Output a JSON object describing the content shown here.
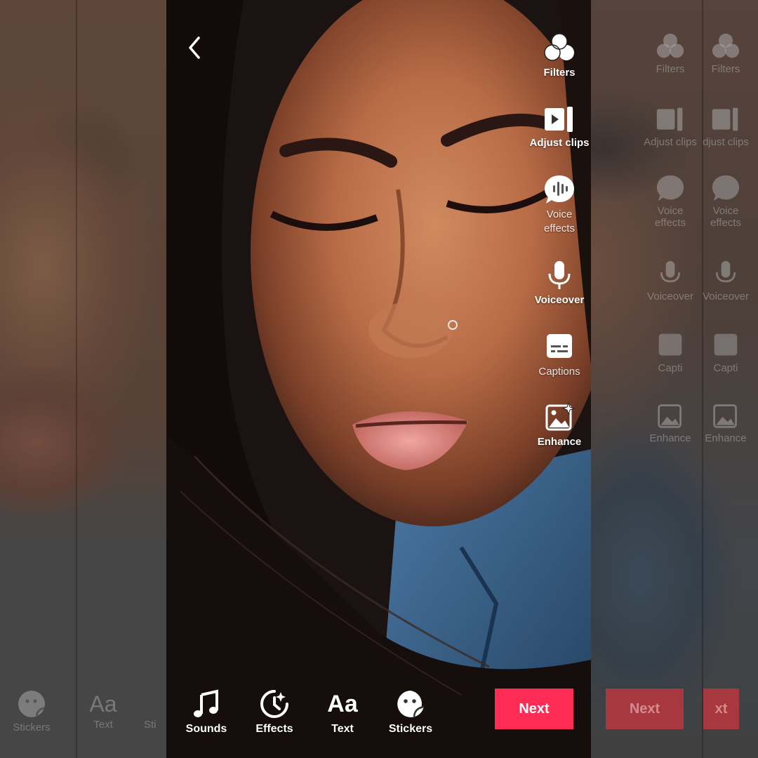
{
  "colors": {
    "accent": "#fe2c55",
    "ghost_accent": "#a8383f",
    "icon": "#ffffff"
  },
  "nav": {
    "back_icon": "chevron-left-icon"
  },
  "side_tools": [
    {
      "id": "filters",
      "label": "Filters",
      "icon": "filters-icon"
    },
    {
      "id": "adjust_clips",
      "label": "Adjust clips",
      "icon": "adjust-clips-icon"
    },
    {
      "id": "voice_effects",
      "label": "Voice\neffects",
      "icon": "voice-effects-icon"
    },
    {
      "id": "voiceover",
      "label": "Voiceover",
      "icon": "microphone-icon"
    },
    {
      "id": "captions",
      "label": "Captions",
      "icon": "captions-icon"
    },
    {
      "id": "enhance",
      "label": "Enhance",
      "icon": "enhance-icon"
    }
  ],
  "bottom_tools": [
    {
      "id": "sounds",
      "label": "Sounds",
      "icon": "music-note-icon"
    },
    {
      "id": "effects",
      "label": "Effects",
      "icon": "effects-icon"
    },
    {
      "id": "text",
      "label": "Text",
      "icon": "text-aa-icon",
      "glyph": "Aa"
    },
    {
      "id": "stickers",
      "label": "Stickers",
      "icon": "sticker-icon"
    }
  ],
  "next_button": {
    "label": "Next"
  },
  "ghost_left": {
    "bottom_tools": [
      {
        "label": "Stickers"
      },
      {
        "label": "Text",
        "glyph": "Aa"
      },
      {
        "label": "Sti"
      }
    ]
  },
  "ghost_right": {
    "panels": [
      {
        "tools": [
          "Filters",
          "Adjust clips",
          "Voice\neffects",
          "Voiceover",
          "Capti",
          "Enhance"
        ],
        "next": "Next"
      },
      {
        "tools": [
          "Filters",
          "djust clips",
          "Voice\neffects",
          "Voiceover",
          "Capti",
          "Enhance"
        ],
        "next": "xt"
      }
    ]
  }
}
